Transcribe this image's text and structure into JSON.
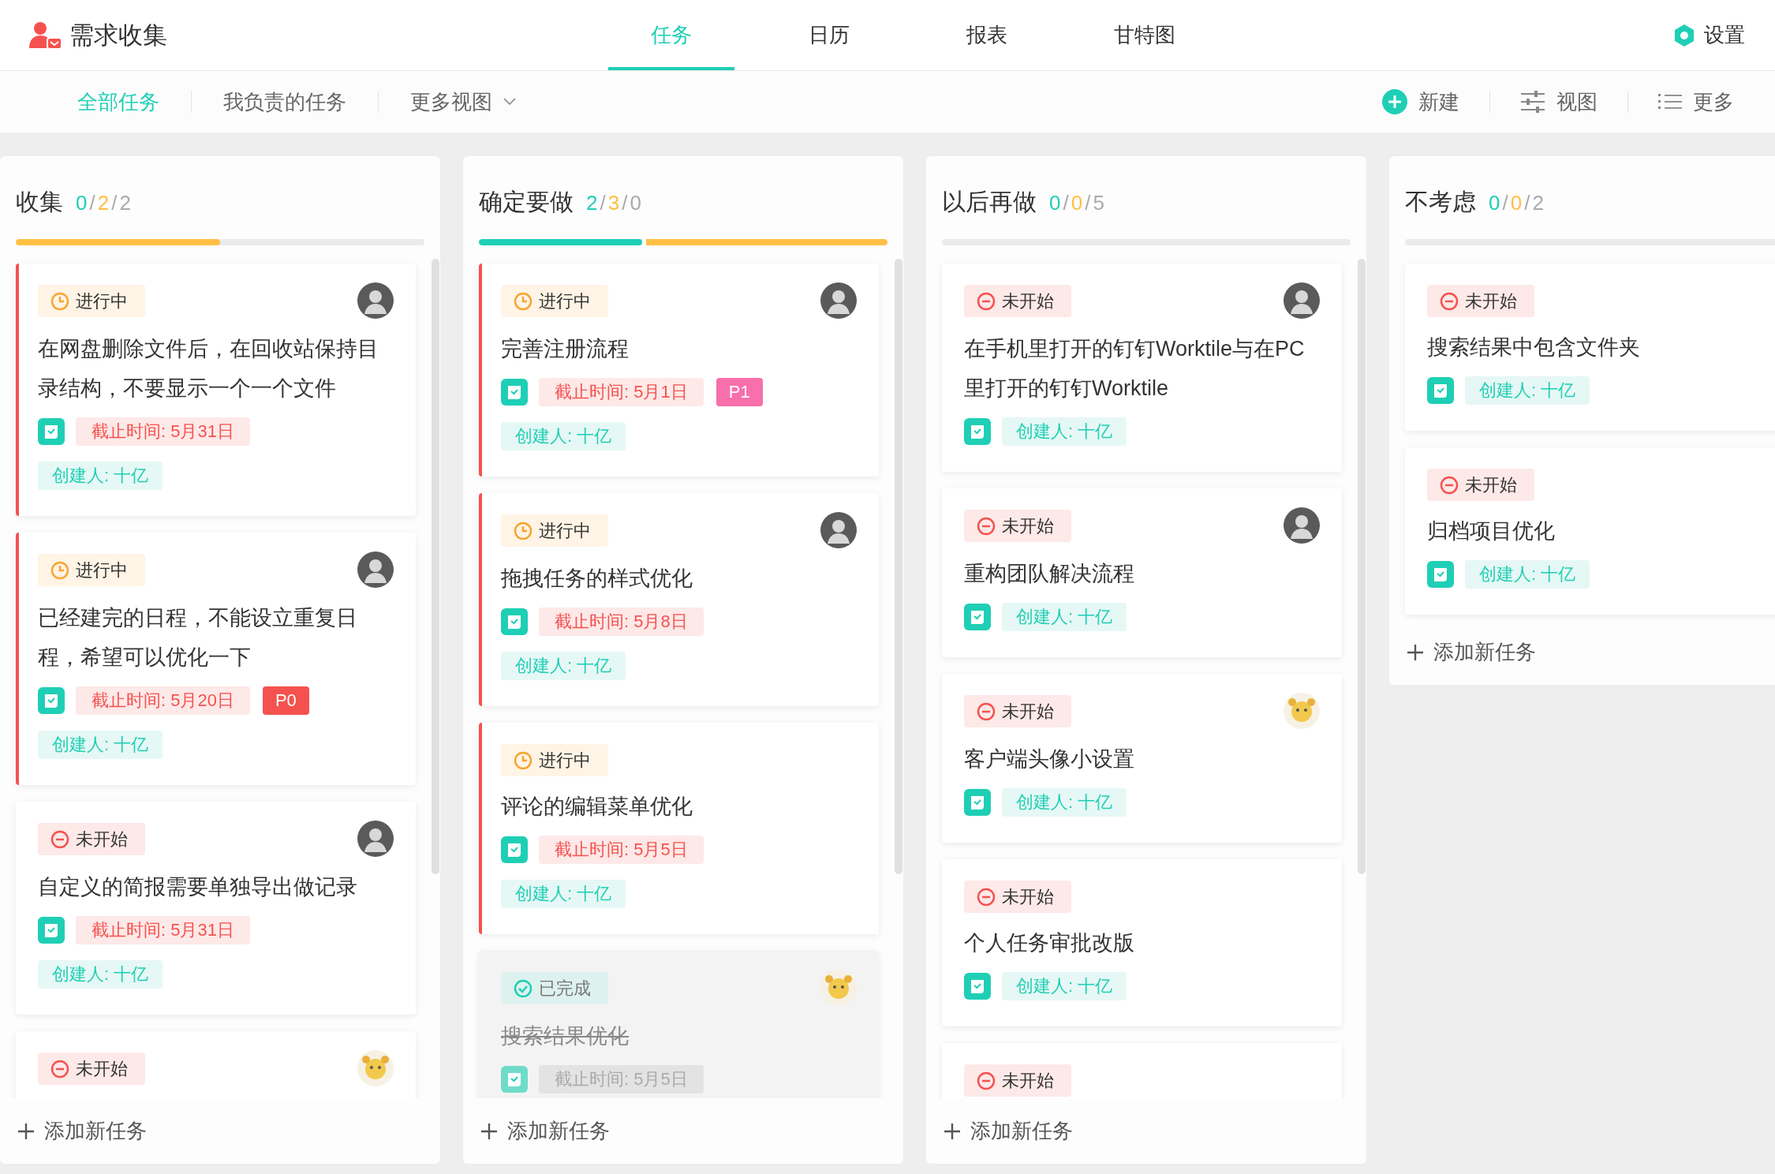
{
  "app": {
    "title": "需求收集"
  },
  "tabs": [
    {
      "label": "任务",
      "selected": true
    },
    {
      "label": "日历",
      "selected": false
    },
    {
      "label": "报表",
      "selected": false
    },
    {
      "label": "甘特图",
      "selected": false
    }
  ],
  "settings": {
    "label": "设置"
  },
  "views": [
    {
      "label": "全部任务",
      "selected": true,
      "dropdown": false
    },
    {
      "label": "我负责的任务",
      "selected": false,
      "dropdown": false
    },
    {
      "label": "更多视图",
      "selected": false,
      "dropdown": true
    }
  ],
  "actions": [
    {
      "kind": "new",
      "label": "新建"
    },
    {
      "kind": "view",
      "label": "视图"
    },
    {
      "kind": "more",
      "label": "更多"
    }
  ],
  "columns": [
    {
      "title": "收集",
      "scrollable": true,
      "progress": [
        {
          "kind": "doing",
          "level": 0.5
        }
      ],
      "counts": [
        {
          "kind": "done",
          "text": "0"
        },
        {
          "kind": "sep",
          "text": "/"
        },
        {
          "kind": "doing",
          "text": "2"
        },
        {
          "kind": "sep",
          "text": "/"
        },
        {
          "kind": "todo",
          "text": "2"
        }
      ],
      "add_label": "添加新任务",
      "cards": [
        {
          "status": {
            "kind": "in_progress",
            "label": "进行中"
          },
          "avatar": {
            "kind": "photo"
          },
          "title": "在网盘删除文件后，在回收站保持目录结构，不要显示一个一个文件",
          "deadline": "截止时间: 5月31日",
          "creator": "创建人: 十亿"
        },
        {
          "status": {
            "kind": "in_progress",
            "label": "进行中"
          },
          "avatar": {
            "kind": "photo"
          },
          "title": "已经建完的日程，不能设立重复日程，希望可以优化一下",
          "deadline": "截止时间: 5月20日",
          "priority": {
            "label": "P0",
            "color": "#f5524f"
          },
          "creator": "创建人: 十亿"
        },
        {
          "status": {
            "kind": "not_started",
            "label": "未开始"
          },
          "avatar": {
            "kind": "photo"
          },
          "title": "自定义的简报需要单独导出做记录",
          "deadline": "截止时间: 5月31日",
          "creator": "创建人: 十亿"
        },
        {
          "status": {
            "kind": "not_started",
            "label": "未开始"
          },
          "avatar": {
            "kind": "cartoon"
          }
        }
      ]
    },
    {
      "title": "确定要做",
      "scrollable": true,
      "progress": [
        {
          "kind": "done",
          "level": 0.4
        },
        {
          "kind": "doing",
          "level": 0.6
        }
      ],
      "counts": [
        {
          "kind": "done",
          "text": "2"
        },
        {
          "kind": "sep",
          "text": "/"
        },
        {
          "kind": "doing",
          "text": "3"
        },
        {
          "kind": "sep",
          "text": "/"
        },
        {
          "kind": "todo",
          "text": "0"
        }
      ],
      "add_label": "添加新任务",
      "cards": [
        {
          "status": {
            "kind": "in_progress",
            "label": "进行中"
          },
          "avatar": {
            "kind": "photo"
          },
          "title": "完善注册流程",
          "deadline": "截止时间: 5月1日",
          "priority": {
            "label": "P1",
            "color": "#f76fab"
          },
          "creator": "创建人: 十亿"
        },
        {
          "status": {
            "kind": "in_progress",
            "label": "进行中"
          },
          "avatar": {
            "kind": "photo"
          },
          "title": "拖拽任务的样式优化",
          "deadline": "截止时间: 5月8日",
          "creator": "创建人: 十亿"
        },
        {
          "status": {
            "kind": "in_progress",
            "label": "进行中"
          },
          "title": "评论的编辑菜单优化",
          "deadline": "截止时间: 5月5日",
          "creator": "创建人: 十亿"
        },
        {
          "status": {
            "kind": "done",
            "label": "已完成"
          },
          "avatar": {
            "kind": "cartoon"
          },
          "title": "搜索结果优化",
          "deadline": "截止时间: 5月5日"
        }
      ]
    },
    {
      "title": "以后再做",
      "scrollable": true,
      "counts": [
        {
          "kind": "done",
          "text": "0"
        },
        {
          "kind": "sep",
          "text": "/"
        },
        {
          "kind": "doing",
          "text": "0"
        },
        {
          "kind": "sep",
          "text": "/"
        },
        {
          "kind": "todo",
          "text": "5"
        }
      ],
      "add_label": "添加新任务",
      "cards": [
        {
          "status": {
            "kind": "not_started",
            "label": "未开始"
          },
          "avatar": {
            "kind": "photo"
          },
          "title": "在手机里打开的钉钉Worktile与在PC里打开的钉钉Worktile",
          "creator": "创建人: 十亿"
        },
        {
          "status": {
            "kind": "not_started",
            "label": "未开始"
          },
          "avatar": {
            "kind": "photo"
          },
          "title": "重构团队解决流程",
          "creator": "创建人: 十亿"
        },
        {
          "status": {
            "kind": "not_started",
            "label": "未开始"
          },
          "avatar": {
            "kind": "cartoon"
          },
          "title": "客户端头像小设置",
          "creator": "创建人: 十亿"
        },
        {
          "status": {
            "kind": "not_started",
            "label": "未开始"
          },
          "title": "个人任务审批改版",
          "creator": "创建人: 十亿"
        },
        {
          "status": {
            "kind": "not_started",
            "label": "未开始"
          }
        }
      ]
    },
    {
      "title": "不考虑",
      "scrollable": false,
      "counts": [
        {
          "kind": "done",
          "text": "0"
        },
        {
          "kind": "sep",
          "text": "/"
        },
        {
          "kind": "doing",
          "text": "0"
        },
        {
          "kind": "sep",
          "text": "/"
        },
        {
          "kind": "todo",
          "text": "2"
        }
      ],
      "add_label": "添加新任务",
      "cards": [
        {
          "status": {
            "kind": "not_started",
            "label": "未开始"
          },
          "title": "搜索结果中包含文件夹",
          "creator": "创建人: 十亿"
        },
        {
          "status": {
            "kind": "not_started",
            "label": "未开始"
          },
          "title": "归档项目优化",
          "creator": "创建人: 十亿"
        }
      ]
    }
  ]
}
